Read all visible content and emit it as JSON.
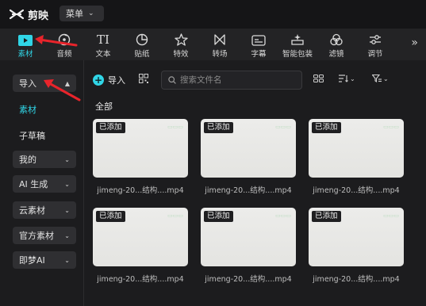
{
  "app": {
    "name": "剪映",
    "menu_label": "菜单"
  },
  "toolbar": {
    "items": [
      {
        "id": "media",
        "label": "素材",
        "icon": "play-icon",
        "active": true
      },
      {
        "id": "audio",
        "label": "音频",
        "icon": "music-icon",
        "active": false
      },
      {
        "id": "text",
        "label": "文本",
        "icon": "text-icon",
        "active": false
      },
      {
        "id": "sticker",
        "label": "贴纸",
        "icon": "sticker-icon",
        "active": false
      },
      {
        "id": "effects",
        "label": "特效",
        "icon": "star-icon",
        "active": false
      },
      {
        "id": "transition",
        "label": "转场",
        "icon": "transition-icon",
        "active": false
      },
      {
        "id": "caption",
        "label": "字幕",
        "icon": "caption-icon",
        "active": false
      },
      {
        "id": "smart-pack",
        "label": "智能包装",
        "icon": "sparkle-icon",
        "active": false
      },
      {
        "id": "filter",
        "label": "滤镜",
        "icon": "filter-icon",
        "active": false
      },
      {
        "id": "adjust",
        "label": "调节",
        "icon": "sliders-icon",
        "active": false
      }
    ],
    "more_icon": "double-chevron-right-icon"
  },
  "sidebar": {
    "import_label": "导入",
    "material_label": "素材",
    "draft_label": "子草稿",
    "mine_label": "我的",
    "ai_label": "AI 生成",
    "cloud_label": "云素材",
    "official_label": "官方素材",
    "jimeng_label": "即梦AI"
  },
  "main": {
    "import_label": "导入",
    "search_placeholder": "搜索文件名",
    "section_title": "全部",
    "cards": [
      {
        "badge": "已添加",
        "name": "jimeng-20...结构....mp4"
      },
      {
        "badge": "已添加",
        "name": "jimeng-20...结构....mp4"
      },
      {
        "badge": "已添加",
        "name": "jimeng-20...结构....mp4"
      },
      {
        "badge": "已添加",
        "name": "jimeng-20...结构....mp4"
      },
      {
        "badge": "已添加",
        "name": "jimeng-20...结构....mp4"
      },
      {
        "badge": "已添加",
        "name": "jimeng-20...结构....mp4"
      }
    ]
  },
  "colors": {
    "accent": "#30d5e6",
    "annotation_arrow": "#e8242b"
  }
}
